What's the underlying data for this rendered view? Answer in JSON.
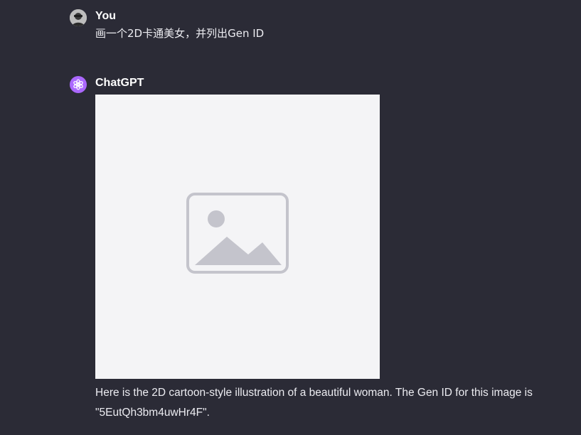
{
  "messages": {
    "user": {
      "author": "You",
      "text": "画一个2D卡通美女，并列出Gen ID"
    },
    "assistant": {
      "author": "ChatGPT",
      "image_icon": "generated-image",
      "reply": "Here is the 2D cartoon-style illustration of a beautiful woman. The Gen ID for this image is \"5EutQh3bm4uwHr4F\"."
    }
  },
  "icons": {
    "user_avatar": "user-avatar-icon",
    "assistant_avatar": "openai-logo-icon"
  },
  "colors": {
    "background": "#2b2b36",
    "assistant_avatar_bg": "#ab68ff",
    "text": "#ececf1"
  }
}
